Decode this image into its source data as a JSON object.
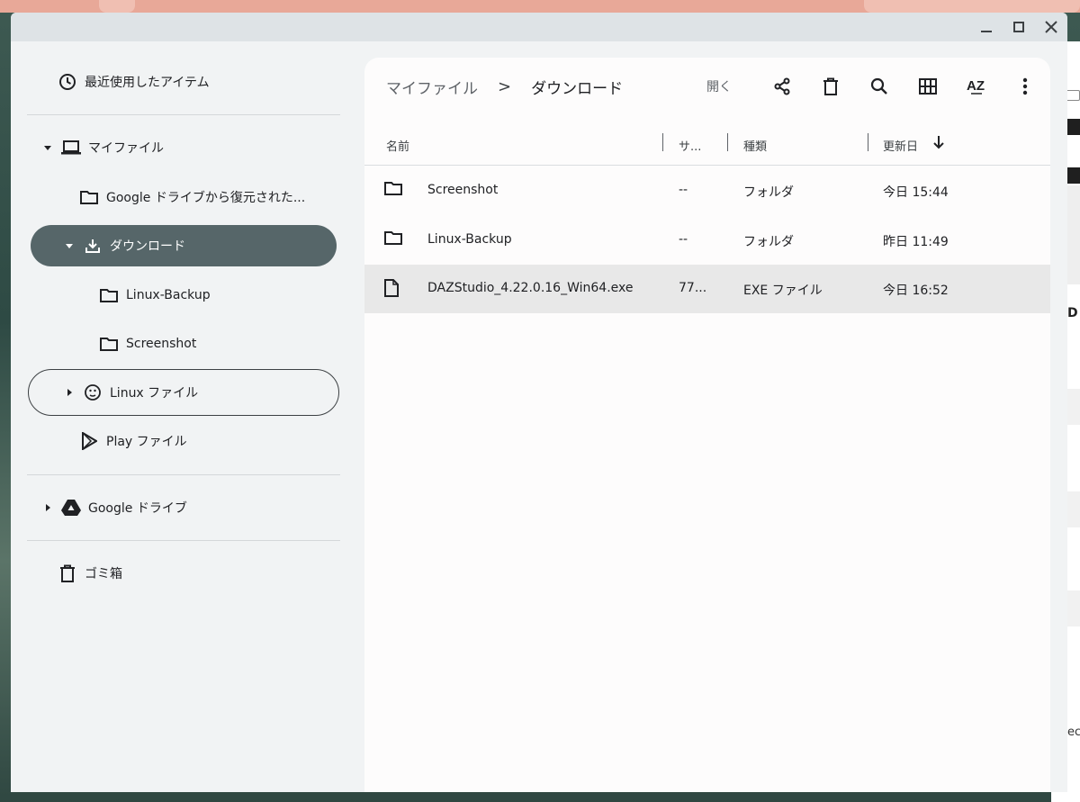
{
  "window": {
    "controls": {
      "minimize": "minimize-icon",
      "maximize": "maximize-icon",
      "close": "close-icon"
    }
  },
  "sidebar": {
    "recent": {
      "label": "最近使用したアイテム",
      "icon": "clock-icon"
    },
    "my_files": {
      "label": "マイファイル",
      "icon": "laptop-icon",
      "expanded": true
    },
    "google_restored": {
      "label": "Google ドライブから復元された...",
      "icon": "folder-icon"
    },
    "downloads": {
      "label": "ダウンロード",
      "icon": "download-icon",
      "expanded": true,
      "selected": true
    },
    "linux_backup": {
      "label": "Linux-Backup",
      "icon": "folder-icon"
    },
    "screenshot": {
      "label": "Screenshot",
      "icon": "folder-icon"
    },
    "linux_files": {
      "label": "Linux ファイル",
      "icon": "penguin-icon",
      "focused": true
    },
    "play_files": {
      "label": "Play ファイル",
      "icon": "play-store-icon"
    },
    "google_drive": {
      "label": "Google ドライブ",
      "icon": "google-drive-icon"
    },
    "trash": {
      "label": "ゴミ箱",
      "icon": "trash-icon"
    }
  },
  "breadcrumb": {
    "root": "マイファイル",
    "separator": ">",
    "current": "ダウンロード"
  },
  "toolbar": {
    "open_label": "開く",
    "icons": [
      "share-icon",
      "delete-icon",
      "search-icon",
      "grid-view-icon",
      "sort-az-icon",
      "more-vert-icon"
    ]
  },
  "columns": {
    "name": "名前",
    "size": "サ...",
    "type": "種類",
    "modified": "更新日",
    "sort_icon": "arrow-down-icon"
  },
  "files": [
    {
      "name": "Screenshot",
      "size": "--",
      "type": "フォルダ",
      "modified": "今日 15:44",
      "icon": "folder-icon",
      "selected": false
    },
    {
      "name": "Linux-Backup",
      "size": "--",
      "type": "フォルダ",
      "modified": "昨日 11:49",
      "icon": "folder-icon",
      "selected": false
    },
    {
      "name": "DAZStudio_4.22.0.16_Win64.exe",
      "size": "77...",
      "type": "EXE ファイル",
      "modified": "今日 16:52",
      "icon": "file-icon",
      "selected": true
    }
  ],
  "background_window": {
    "peek_text_1": "D",
    "peek_text_2": "ec"
  },
  "colors": {
    "active_nav": "#566669",
    "selected_row": "#e8e8e8",
    "sidebar_bg": "#f1f3f4",
    "content_bg": "#fdfcfc"
  }
}
